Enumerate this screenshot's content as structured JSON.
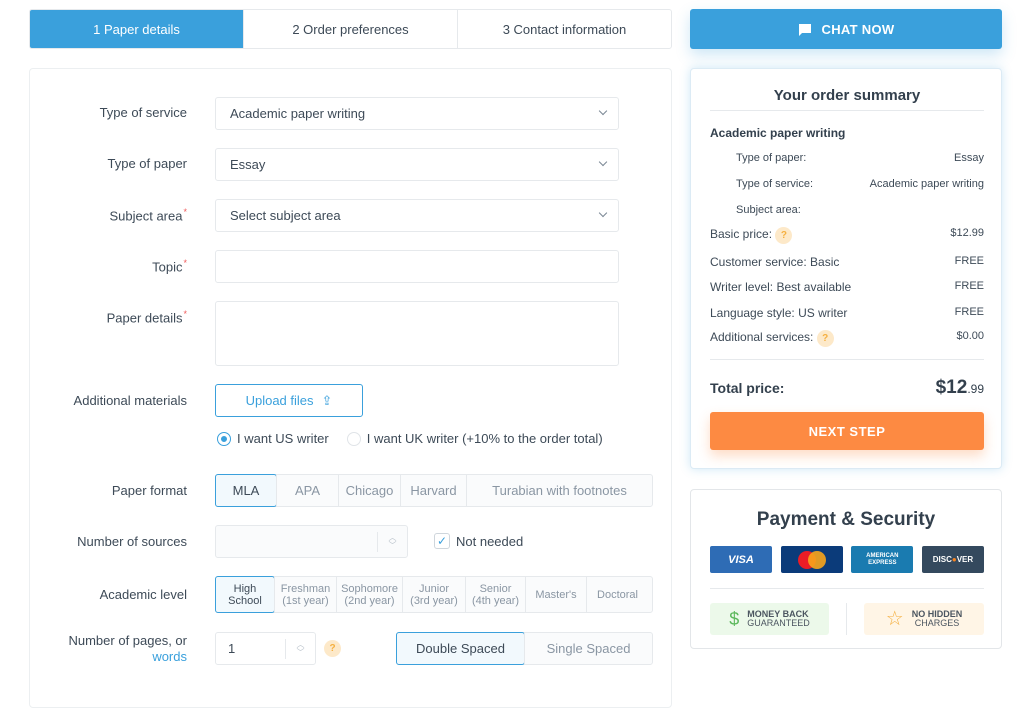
{
  "steps": [
    {
      "label": "1 Paper details",
      "active": true
    },
    {
      "label": "2 Order preferences"
    },
    {
      "label": "3 Contact information"
    }
  ],
  "form": {
    "type_of_service": {
      "label": "Type of service",
      "value": "Academic paper writing"
    },
    "type_of_paper": {
      "label": "Type of paper",
      "value": "Essay"
    },
    "subject_area": {
      "label": "Subject area",
      "placeholder": "Select subject area",
      "required": "*"
    },
    "topic": {
      "label": "Topic",
      "required": "*",
      "value": ""
    },
    "paper_details": {
      "label": "Paper details",
      "required": "*",
      "value": ""
    },
    "additional_materials": {
      "label": "Additional materials",
      "upload_label": "Upload files",
      "upload_icon": "upload-icon"
    },
    "writer": {
      "us_label": "I want US writer",
      "uk_label": "I want UK writer (+10% to the order total)",
      "selected": "us"
    },
    "paper_format": {
      "label": "Paper format",
      "options": [
        "MLA",
        "APA",
        "Chicago",
        "Harvard",
        "Turabian with footnotes"
      ],
      "selected": "MLA"
    },
    "sources": {
      "label": "Number of sources",
      "value": "",
      "not_needed_label": "Not needed",
      "not_needed_checked": true
    },
    "academic_level": {
      "label": "Academic level",
      "options": [
        [
          "High",
          "School"
        ],
        [
          "Freshman",
          "(1st year)"
        ],
        [
          "Sophomore",
          "(2nd year)"
        ],
        [
          "Junior",
          "(3rd year)"
        ],
        [
          "Senior",
          "(4th year)"
        ],
        [
          "Master's",
          ""
        ],
        [
          "Doctoral",
          ""
        ]
      ],
      "selected": 0
    },
    "pages": {
      "label_1": "Number of pages, or",
      "label_2": "words",
      "value": "1",
      "help": "?",
      "spacing_options": [
        "Double Spaced",
        "Single Spaced"
      ],
      "spacing_selected": "Double Spaced"
    }
  },
  "chat": {
    "label": "CHAT NOW",
    "icon": "chat-icon"
  },
  "summary": {
    "title": "Your order summary",
    "service_heading": "Academic paper writing",
    "details": [
      {
        "k": "Type of paper:",
        "v": "Essay"
      },
      {
        "k": "Type of service:",
        "v": "Academic paper writing"
      },
      {
        "k": "Subject area:",
        "v": ""
      }
    ],
    "lines": [
      {
        "k": "Basic price:",
        "v": "$12.99",
        "help": true
      },
      {
        "k": "Customer service: Basic",
        "v": "FREE"
      },
      {
        "k": "Writer level: Best available",
        "v": "FREE"
      },
      {
        "k": "Language style: US writer",
        "v": "FREE"
      },
      {
        "k": "Additional services:",
        "v": "$0.00",
        "help": true
      }
    ],
    "total_label": "Total price:",
    "total_main": "$12",
    "total_cents": ".99",
    "next_label": "NEXT STEP"
  },
  "payment": {
    "title": "Payment & Security",
    "cards": [
      {
        "name": "VISA",
        "color": "#2e6cb5"
      },
      {
        "name": "MasterCard",
        "color": "#0b3b7a"
      },
      {
        "name": "AMERICAN EXPRESS",
        "color": "#1a7bb0"
      },
      {
        "name": "DISCOVER",
        "color": "#34495e"
      }
    ],
    "badges": [
      {
        "line1": "MONEY BACK",
        "line2": "GUARANTEED",
        "icon": "$"
      },
      {
        "line1": "NO HIDDEN",
        "line2": "CHARGES",
        "icon": "☆"
      }
    ]
  }
}
